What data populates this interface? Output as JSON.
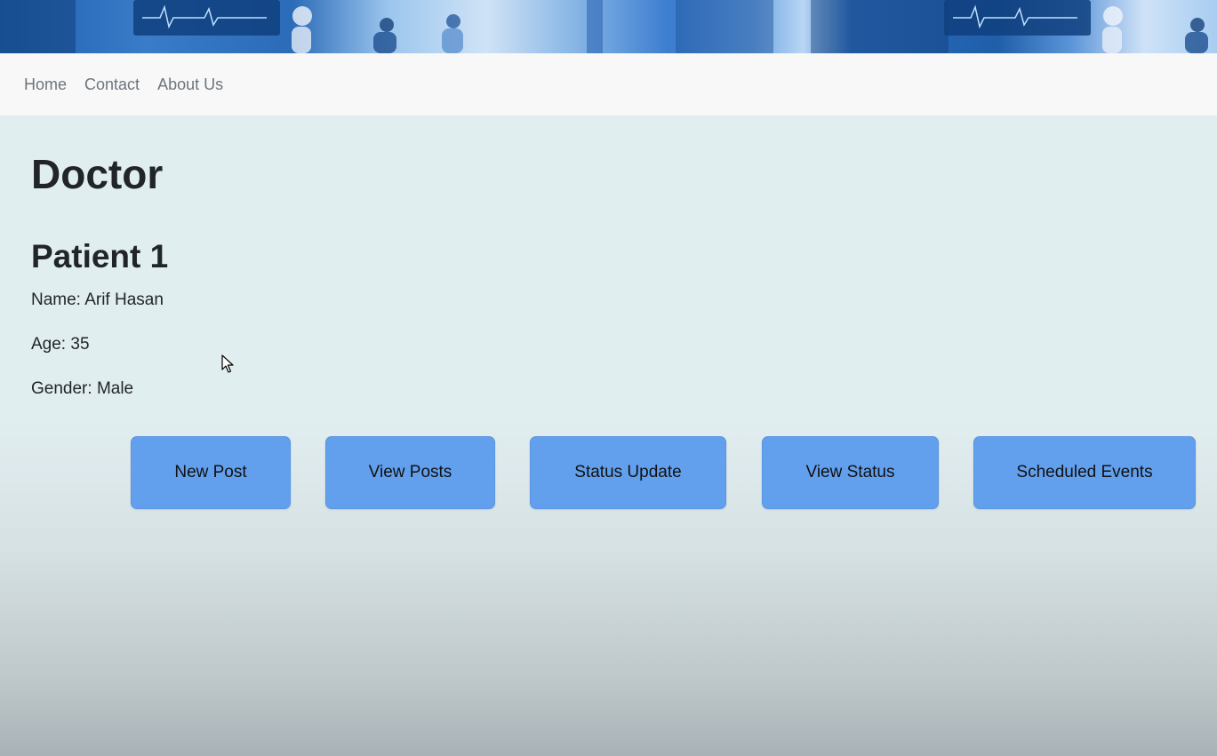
{
  "nav": {
    "items": [
      {
        "label": "Home"
      },
      {
        "label": "Contact"
      },
      {
        "label": "About Us"
      }
    ]
  },
  "page": {
    "title": "Doctor"
  },
  "patient": {
    "heading": "Patient 1",
    "name_label": "Name:",
    "name": "Arif Hasan",
    "age_label": "Age:",
    "age": "35",
    "gender_label": "Gender:",
    "gender": "Male"
  },
  "actions": [
    {
      "label": "New Post"
    },
    {
      "label": "View Posts"
    },
    {
      "label": "Status Update"
    },
    {
      "label": "View Status"
    },
    {
      "label": "Scheduled Events"
    }
  ],
  "colors": {
    "button_bg": "#62a0ee",
    "navbar_bg": "#f8f8f8",
    "page_bg": "#e1eef0",
    "text": "#212529",
    "nav_text": "#6c757d"
  },
  "icons": {
    "cursor": "mouse-pointer-icon",
    "banner": "hospital-banner-image"
  }
}
